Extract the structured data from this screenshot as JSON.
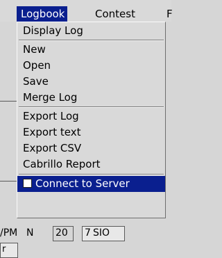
{
  "menubar": {
    "items": [
      {
        "label": "Logbook",
        "active": true
      },
      {
        "label": "Contest",
        "active": false
      },
      {
        "label": "F",
        "active": false
      }
    ]
  },
  "logbook_menu": {
    "items": [
      {
        "label": "Display Log"
      },
      {
        "label": "New"
      },
      {
        "label": "Open"
      },
      {
        "label": "Save"
      },
      {
        "label": "Merge Log"
      },
      {
        "label": "Export Log"
      },
      {
        "label": "Export text"
      },
      {
        "label": "Export CSV"
      },
      {
        "label": "Cabrillo Report"
      },
      {
        "label": "Connect to Server",
        "checkbox": true,
        "checked": false
      }
    ]
  },
  "background": {
    "fragments": [
      "r",
      "/PM",
      "N",
      "20",
      "7",
      "SIO"
    ]
  },
  "colors": {
    "highlight": "#0a1f8f",
    "menu_bg": "#d9d9d9"
  }
}
